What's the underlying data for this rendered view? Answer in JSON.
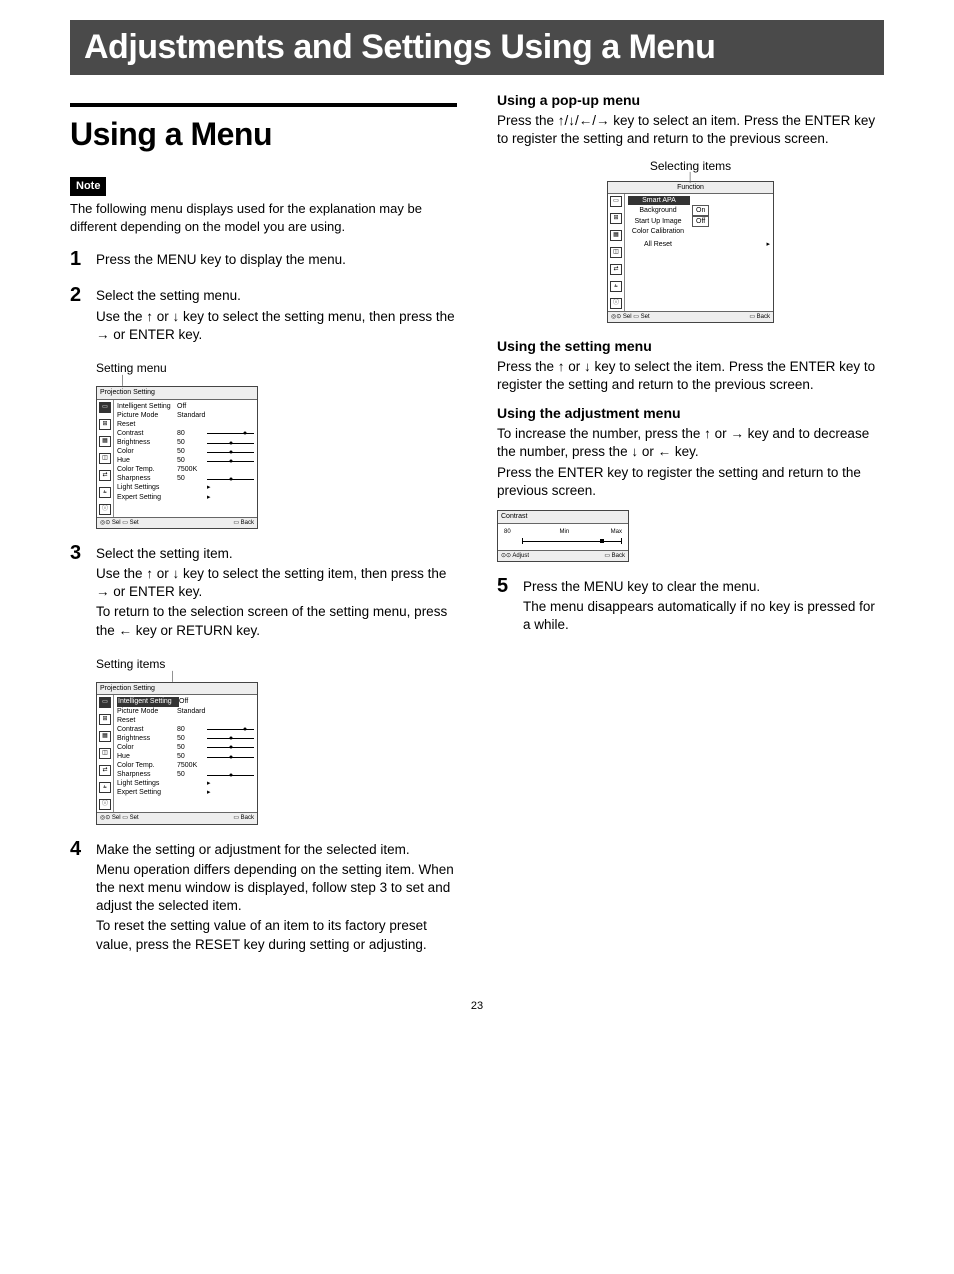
{
  "banner": "Adjustments and Settings Using a Menu",
  "section_title": "Using a Menu",
  "note": {
    "badge": "Note",
    "text": "The following menu displays used for the explanation may be different depending on the model you are using."
  },
  "steps": {
    "s1": {
      "num": "1",
      "main": "Press the MENU key to display the menu."
    },
    "s2": {
      "num": "2",
      "main": "Select the setting menu.",
      "sub": "Use the ↑ or ↓ key to select the setting menu, then press the → or ENTER key."
    },
    "s3": {
      "num": "3",
      "main": "Select the setting item.",
      "sub1": "Use the ↑ or ↓ key to select the setting item, then press the → or ENTER key.",
      "sub2": "To return to the selection screen of the setting menu, press the ← key or RETURN key."
    },
    "s4": {
      "num": "4",
      "main": "Make the setting or adjustment for the selected item.",
      "sub1": "Menu operation differs depending on the setting item. When the next menu window is displayed, follow step 3 to set and adjust the selected item.",
      "sub2": "To reset the setting value of an item to its factory preset value, press the RESET key during setting or adjusting."
    },
    "s5": {
      "num": "5",
      "main": "Press the MENU key to clear the menu.",
      "sub": "The menu disappears automatically if no key is pressed for a while."
    }
  },
  "labels": {
    "setting_menu": "Setting menu",
    "setting_items": "Setting items",
    "selecting_items": "Selecting items"
  },
  "right": {
    "popup_head": "Using a pop-up menu",
    "popup_text": "Press the ↑/↓/←/→ key to select an item. Press the ENTER key to register the setting and return to the previous screen.",
    "setting_head": "Using the setting menu",
    "setting_text": "Press the ↑ or ↓ key to select the item. Press the ENTER key to register the setting and return to the previous screen.",
    "adj_head": "Using the adjustment menu",
    "adj_text1": "To increase the number, press the ↑ or → key and to decrease the number, press the ↓ or ← key.",
    "adj_text2": "Press the ENTER key to register the setting and return to the previous screen."
  },
  "menu1": {
    "title": "Projection Setting",
    "rows": [
      {
        "label": "Intelligent Setting",
        "val": "Off",
        "slider": null,
        "arrow": false
      },
      {
        "label": "Picture Mode",
        "val": "Standard",
        "slider": null,
        "arrow": false
      },
      {
        "label": "Reset",
        "val": "",
        "slider": null,
        "arrow": false
      },
      {
        "label": "Contrast",
        "val": "80",
        "slider": 80,
        "arrow": false
      },
      {
        "label": "Brightness",
        "val": "50",
        "slider": 50,
        "arrow": false
      },
      {
        "label": "Color",
        "val": "50",
        "slider": 50,
        "arrow": false
      },
      {
        "label": "Hue",
        "val": "50",
        "slider": 50,
        "arrow": false
      },
      {
        "label": "Color Temp.",
        "val": "7500K",
        "slider": null,
        "arrow": false
      },
      {
        "label": "Sharpness",
        "val": "50",
        "slider": 50,
        "arrow": false
      },
      {
        "label": "Light Settings",
        "val": "",
        "slider": null,
        "arrow": true
      },
      {
        "label": "Expert Setting",
        "val": "",
        "slider": null,
        "arrow": true
      }
    ],
    "footer_left": "◎⊙ Sel   ▭ Set",
    "footer_right": "▭ Back"
  },
  "menu2_selected_row": 0,
  "popup": {
    "title": "Function",
    "rows": [
      {
        "label": "Smart APA",
        "val": ""
      },
      {
        "label": "Background",
        "val": "On"
      },
      {
        "label": "Start Up Image",
        "val": "Off"
      },
      {
        "label": "Color Calibration",
        "val": ""
      },
      {
        "label": "All Reset",
        "val": "",
        "arrow": true
      }
    ],
    "footer_left": "◎⊙ Sel   ▭ Set",
    "footer_right": "▭ Back"
  },
  "adjust": {
    "title": "Contrast",
    "value": "80",
    "min_label": "Min",
    "max_label": "Max",
    "pos": 80,
    "footer_left": "⊙⊙ Adjust",
    "footer_right": "▭ Back"
  },
  "page_number": "23"
}
